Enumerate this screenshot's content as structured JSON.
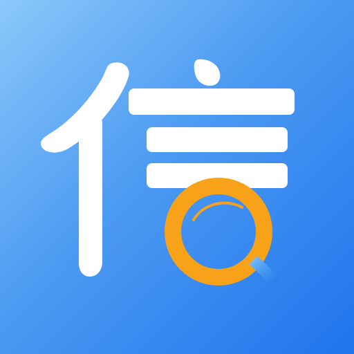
{
  "icon": {
    "name": "app-icon",
    "glyph": "信",
    "colors": {
      "gradient_start": "#8BC8FA",
      "gradient_mid": "#4C9AF2",
      "gradient_end": "#1F74EC",
      "glyph": "#FFFFFF",
      "ring": "#F8A21A"
    }
  }
}
